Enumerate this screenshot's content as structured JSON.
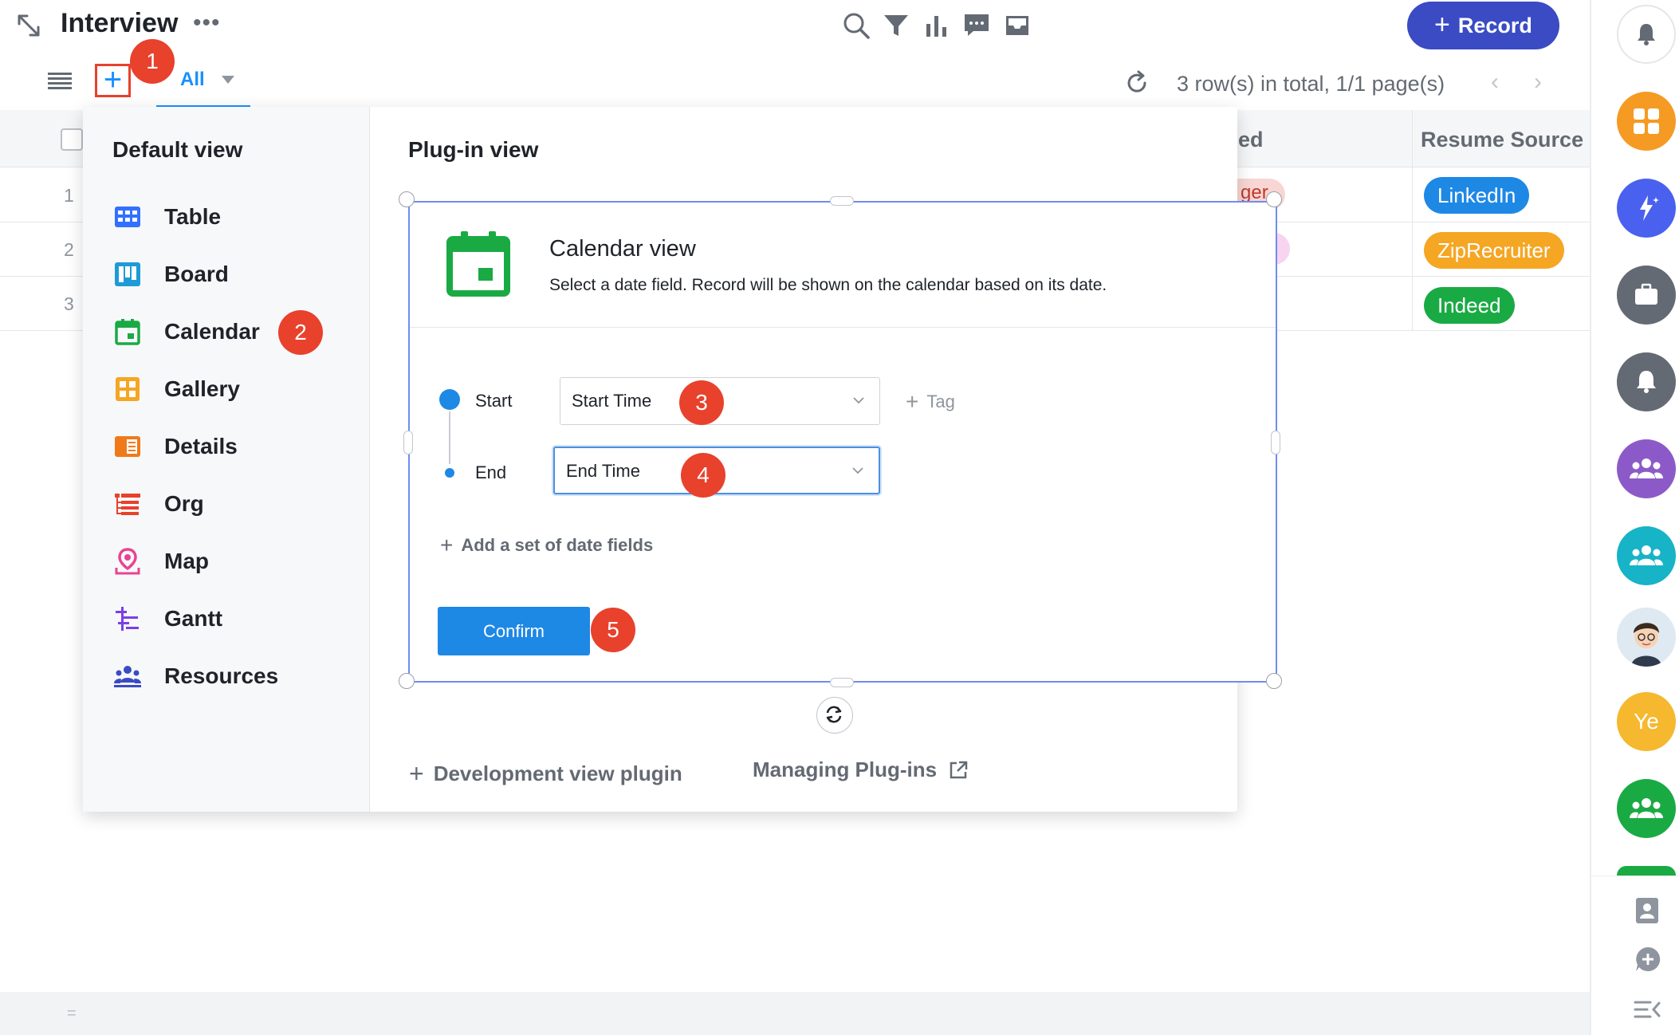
{
  "header": {
    "title": "Interview",
    "more": "•••",
    "record_button": "Record",
    "record_plus": "+",
    "icons": [
      "expand-icon",
      "search-icon",
      "filter-icon",
      "chart-icon",
      "comment-icon",
      "inbox-icon"
    ]
  },
  "toolbar": {
    "add_view": "+",
    "view_tab": "All",
    "row_summary": "3 row(s) in total, 1/1 page(s)",
    "prev": "‹",
    "next": "›"
  },
  "table": {
    "row_numbers": [
      "1",
      "2",
      "3"
    ],
    "partial_header": "ed",
    "partial_cell": "ger",
    "column_header": "Resume Source",
    "resume_sources": [
      {
        "label": "LinkedIn",
        "color": "#1e88e5"
      },
      {
        "label": "ZipRecruiter",
        "color": "#f5a623"
      },
      {
        "label": "Indeed",
        "color": "#1aaa44"
      }
    ]
  },
  "panel": {
    "default_view_title": "Default view",
    "plugin_view_title": "Plug-in view",
    "default_views": [
      {
        "label": "Table",
        "icon": "table-icon",
        "color": "#3370ff"
      },
      {
        "label": "Board",
        "icon": "board-icon",
        "color": "#1e9bd6"
      },
      {
        "label": "Calendar",
        "icon": "calendar-icon",
        "color": "#1aaa44"
      },
      {
        "label": "Gallery",
        "icon": "gallery-icon",
        "color": "#f5a623"
      },
      {
        "label": "Details",
        "icon": "details-icon",
        "color": "#f07a1a"
      },
      {
        "label": "Org",
        "icon": "org-icon",
        "color": "#e8412c"
      },
      {
        "label": "Map",
        "icon": "map-pin-icon",
        "color": "#e84393"
      },
      {
        "label": "Gantt",
        "icon": "gantt-icon",
        "color": "#7b3fe4"
      },
      {
        "label": "Resources",
        "icon": "resources-icon",
        "color": "#3a4bc4"
      }
    ],
    "calendar_card": {
      "title": "Calendar view",
      "description": "Select a date field. Record will be shown on the calendar based on its date.",
      "start_label": "Start",
      "end_label": "End",
      "start_value": "Start Time",
      "end_value": "End Time",
      "tag_link": "Tag",
      "add_dates": "Add a set of date fields",
      "confirm": "Confirm"
    },
    "dev_plugin": "Development view plugin",
    "managing_plugins": "Managing Plug-ins",
    "plus": "+"
  },
  "badges": [
    "1",
    "2",
    "3",
    "4",
    "5"
  ],
  "sidebar": {
    "apps": [
      {
        "name": "bell-icon",
        "color": "#ffffff"
      },
      {
        "name": "grid-app-icon",
        "color": "#f59a23"
      },
      {
        "name": "magic-app-icon",
        "color": "#4a61ef"
      },
      {
        "name": "briefcase-app-icon",
        "color": "#646a73"
      },
      {
        "name": "bell-app-icon",
        "color": "#646a73"
      },
      {
        "name": "group-app-icon",
        "color": "#8c5ac8"
      },
      {
        "name": "team-app-icon",
        "color": "#17b3c7"
      },
      {
        "name": "user-avatar",
        "color": "#dfe9f2"
      },
      {
        "name": "ye-avatar",
        "color": "#f5b82e"
      },
      {
        "name": "green-group-app-icon",
        "color": "#1aaa44"
      }
    ],
    "avatar_text": "Ye"
  },
  "footer": {
    "grip": "="
  }
}
